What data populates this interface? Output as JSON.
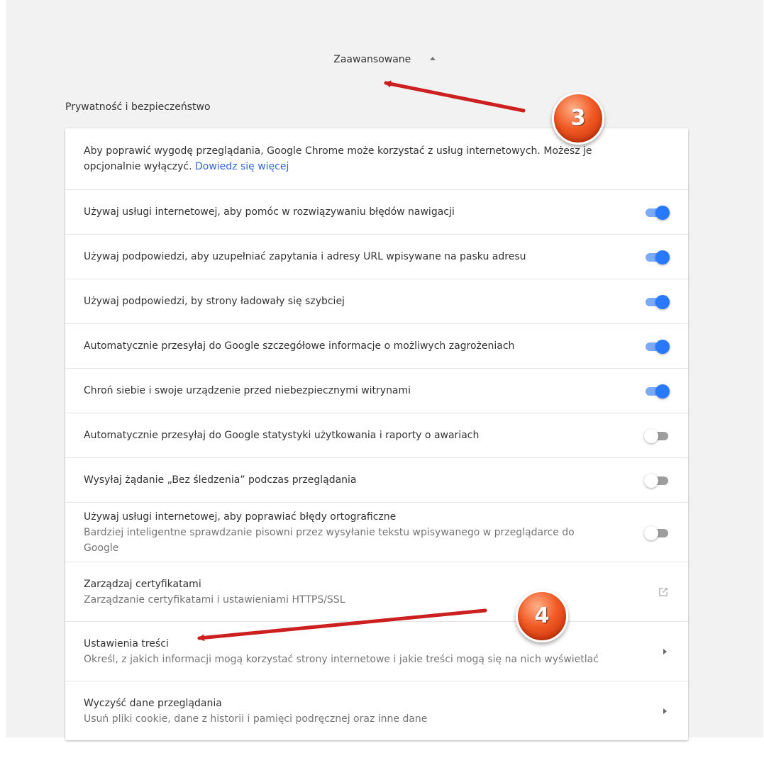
{
  "header": {
    "advanced_label": "Zaawansowane",
    "section_title": "Prywatność i bezpieczeństwo"
  },
  "intro": {
    "text": "Aby poprawić wygodę przeglądania, Google Chrome może korzystać z usług internetowych. Możesz je",
    "text_line2": "opcjonalnie wyłączyć.",
    "link": "Dowiedz się więcej"
  },
  "toggles": [
    {
      "label": "Używaj usługi internetowej, aby pomóc w rozwiązywaniu błędów nawigacji",
      "state": "on"
    },
    {
      "label": "Używaj podpowiedzi, aby uzupełniać zapytania i adresy URL wpisywane na pasku adresu",
      "state": "on"
    },
    {
      "label": "Używaj podpowiedzi, by strony ładowały się szybciej",
      "state": "on"
    },
    {
      "label": "Automatycznie przesyłaj do Google szczegółowe informacje o możliwych zagrożeniach",
      "state": "on"
    },
    {
      "label": "Chroń siebie i swoje urządzenie przed niebezpiecznymi witrynami",
      "state": "on"
    },
    {
      "label": "Automatycznie przesyłaj do Google statystyki użytkowania i raporty o awariach",
      "state": "off"
    },
    {
      "label": "Wysyłaj żądanie „Bez śledzenia” podczas przeglądania",
      "state": "off"
    }
  ],
  "spellcheck": {
    "label": "Używaj usługi internetowej, aby poprawiać błędy ortograficzne",
    "description_line1": "Bardziej inteligentne sprawdzanie pisowni przez wysyłanie tekstu wpisywanego w przeglądarce do",
    "description_line2": "Google",
    "state": "off"
  },
  "links": [
    {
      "label": "Zarządzaj certyfikatami",
      "description": "Zarządzanie certyfikatami i ustawieniami HTTPS/SSL",
      "icon": "external-link-icon"
    },
    {
      "label": "Ustawienia treści",
      "description": "Określ, z jakich informacji mogą korzystać strony internetowe i jakie treści mogą się na nich wyświetlać",
      "icon": "chevron-right-icon"
    },
    {
      "label": "Wyczyść dane przeglądania",
      "description": "Usuń pliki cookie, dane z historii i pamięci podręcznej oraz inne dane",
      "icon": "chevron-right-icon"
    }
  ],
  "annotations": {
    "badge_3": "3",
    "badge_4": "4"
  },
  "colors": {
    "toggle_on": "#2979ff",
    "toggle_off": "#9e9e9e",
    "link": "#3367d6",
    "arrow": "#cc1f1f",
    "badge": "#f05a24"
  }
}
